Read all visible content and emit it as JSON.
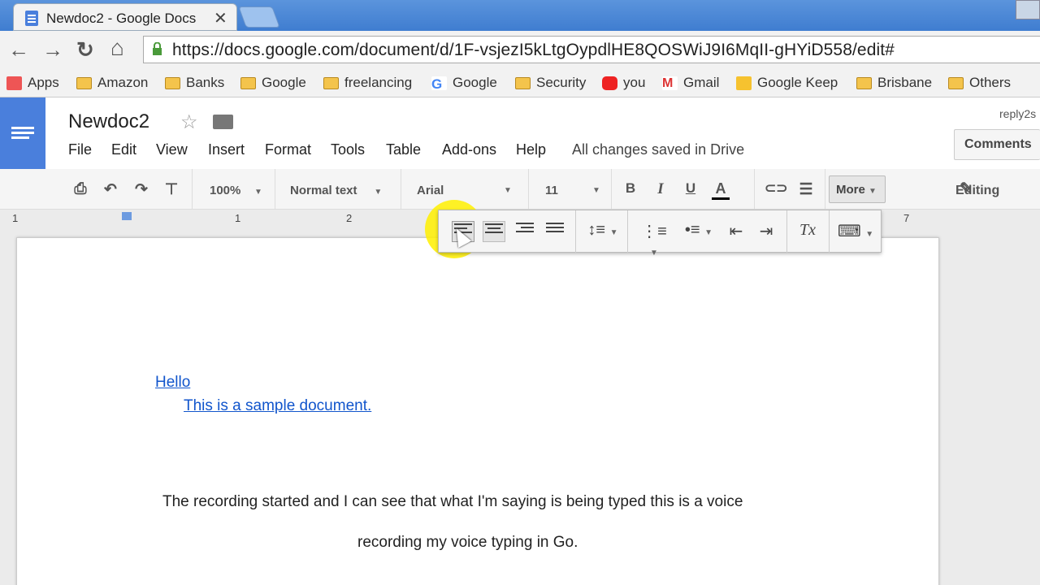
{
  "browser": {
    "tab_title": "Newdoc2 - Google Docs",
    "close_glyph": "✕",
    "url": "https://docs.google.com/document/d/1F-vsjezI5kLtgOypdlHE8QOSWiJ9I6MqII-gHYiD558/edit#",
    "nav": {
      "back": "←",
      "forward": "→",
      "reload": "↻",
      "home": "⌂"
    }
  },
  "bookmarks": [
    {
      "label": "Apps",
      "icon": "apps-grid-icon"
    },
    {
      "label": "Amazon",
      "icon": "folder-icon"
    },
    {
      "label": "Banks",
      "icon": "folder-icon"
    },
    {
      "label": "Google",
      "icon": "folder-icon"
    },
    {
      "label": "freelancing",
      "icon": "folder-icon"
    },
    {
      "label": "Google",
      "icon": "google-g-icon"
    },
    {
      "label": "Security",
      "icon": "folder-icon"
    },
    {
      "label": "you",
      "icon": "youtube-icon"
    },
    {
      "label": "Gmail",
      "icon": "gmail-icon"
    },
    {
      "label": "Google Keep",
      "icon": "keep-icon"
    },
    {
      "label": "Brisbane",
      "icon": "folder-icon"
    },
    {
      "label": "Others",
      "icon": "folder-icon"
    }
  ],
  "docs": {
    "title": "Newdoc2",
    "star": "☆",
    "menus": [
      "File",
      "Edit",
      "View",
      "Insert",
      "Format",
      "Tools",
      "Table",
      "Add-ons",
      "Help"
    ],
    "saved_status": "All changes saved in Drive",
    "account": "reply2s",
    "comments_label": "Comments"
  },
  "toolbar": {
    "zoom": "100%",
    "style": "Normal text",
    "font": "Arial",
    "size": "11",
    "bold": "B",
    "italic": "I",
    "underline": "U",
    "text_color": "A",
    "more_label": "More",
    "editing_label": "Editing"
  },
  "ruler": {
    "left": "1",
    "one": "1",
    "two": "2",
    "seven": "7"
  },
  "document": {
    "line1": "Hello",
    "line2": "This is a sample document.",
    "para1": "The recording started and I can see that what I'm saying is being typed this is a voice",
    "para2": "recording my voice typing in Go."
  },
  "colors": {
    "accent": "#4a7fdc",
    "link": "#1155cc",
    "highlight": "#fff000"
  }
}
